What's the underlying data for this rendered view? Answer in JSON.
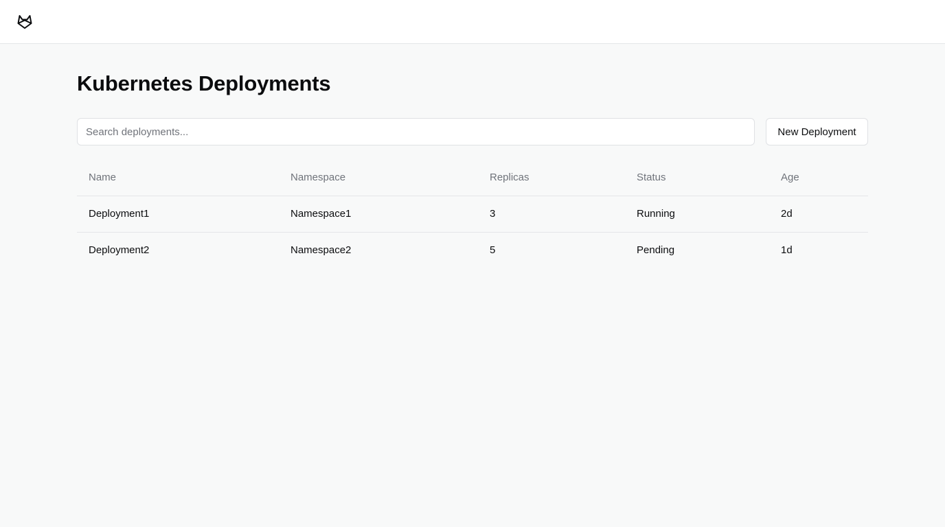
{
  "icons": {
    "logo": "gitlab-fox-logo-icon"
  },
  "page": {
    "title": "Kubernetes Deployments"
  },
  "search": {
    "placeholder": "Search deployments...",
    "value": ""
  },
  "actions": {
    "new_label": "New Deployment"
  },
  "table": {
    "headers": {
      "name": "Name",
      "namespace": "Namespace",
      "replicas": "Replicas",
      "status": "Status",
      "age": "Age"
    },
    "rows": [
      {
        "name": "Deployment1",
        "namespace": "Namespace1",
        "replicas": "3",
        "status": "Running",
        "age": "2d"
      },
      {
        "name": "Deployment2",
        "namespace": "Namespace2",
        "replicas": "5",
        "status": "Pending",
        "age": "1d"
      }
    ]
  },
  "colors": {
    "background": "#f8f9f9",
    "surface": "#ffffff",
    "text": "#0b0c0e",
    "muted": "#6f737a",
    "border": "#e4e6e8"
  }
}
